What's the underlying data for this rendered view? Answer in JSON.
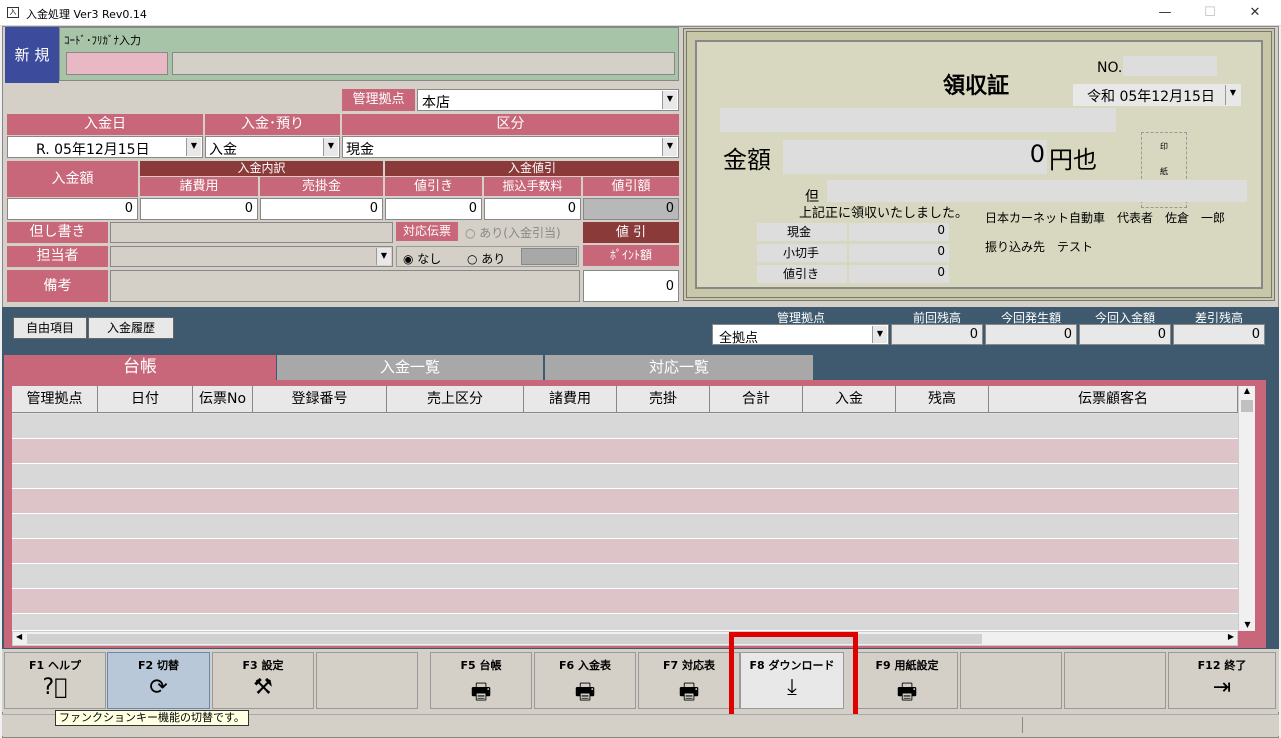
{
  "window": {
    "title": "入金処理 Ver3 Rev0.14",
    "minimize": "—",
    "maximize": "☐",
    "close": "✕"
  },
  "form": {
    "new_button": "新 規",
    "code_label": "ｺｰﾄﾞ･ﾌﾘｶﾞﾅ入力",
    "base_label": "管理拠点",
    "base_value": "本店",
    "deposit_date_label": "入金日",
    "deposit_date_value": "R. 05年12月15日",
    "deposit_type_label": "入金･預り",
    "deposit_type_value": "入金",
    "category_label": "区分",
    "category_value": "現金",
    "amount_label": "入金額",
    "breakdown_label": "入金内訳",
    "misc_label": "諸費用",
    "receivable_label": "売掛金",
    "discount_group_label": "入金値引",
    "discount_label": "値引き",
    "transfer_fee_label": "振込手数料",
    "discount_amount_label": "値引額",
    "amount_value": "0",
    "misc_value": "0",
    "receivable_value": "0",
    "discount_value": "0",
    "transfer_fee_value": "0",
    "discount_amount_value": "0",
    "note_label": "但し書き",
    "staff_label": "担当者",
    "remarks_label": "備考",
    "voucher_label": "対応伝票",
    "radio_ari_deposit": "あり(入金引当)",
    "radio_nashi": "なし",
    "radio_ari": "あり",
    "discount_btn": "値 引",
    "point_label": "ﾎﾟｲﾝﾄ額",
    "point_value": "0"
  },
  "receipt": {
    "title": "領収証",
    "no_label": "NO.",
    "date": "令和 05年12月15日",
    "amount_label": "金額",
    "amount_value": "0",
    "amount_suffix": "円也",
    "tada": "但",
    "received": "上記正に領収いたしました。",
    "stamp1": "印",
    "stamp2": "紙",
    "cash_label": "現金",
    "cash_value": "0",
    "check_label": "小切手",
    "check_value": "0",
    "disc_label": "値引き",
    "disc_value": "0",
    "company": "日本カーネット自動車　代表者　佐倉　一郎",
    "transfer": "振り込み先　テスト"
  },
  "lower": {
    "free_items": "自由項目",
    "history": "入金履歴",
    "base_label": "管理拠点",
    "base_value": "全拠点",
    "prev_balance": "前回残高",
    "current_sales": "今回発生額",
    "current_deposit": "今回入金額",
    "diff_balance": "差引残高",
    "prev_value": "0",
    "sales_value": "0",
    "deposit_value": "0",
    "diff_value": "0",
    "tabs": [
      "台帳",
      "入金一覧",
      "対応一覧"
    ],
    "columns": [
      "管理拠点",
      "日付",
      "伝票No",
      "登録番号",
      "売上区分",
      "諸費用",
      "売掛",
      "合計",
      "入金",
      "残高",
      "伝票顧客名"
    ]
  },
  "fkeys": {
    "f1": "F1 ヘルプ",
    "f2": "F2 切替",
    "f3": "F3 設定",
    "f5": "F5 台帳",
    "f6": "F6 入金表",
    "f7": "F7 対応表",
    "f8": "F8 ダウンロード",
    "f9": "F9 用紙設定",
    "f12": "F12 終了"
  },
  "status": {
    "tooltip": "ファンクションキー機能の切替です。"
  },
  "colors": {
    "accent_pink": "#c8677a",
    "dark_red": "#8b3a3a",
    "highlight_red": "#e00000",
    "lower_bg": "#3f5a6e"
  }
}
